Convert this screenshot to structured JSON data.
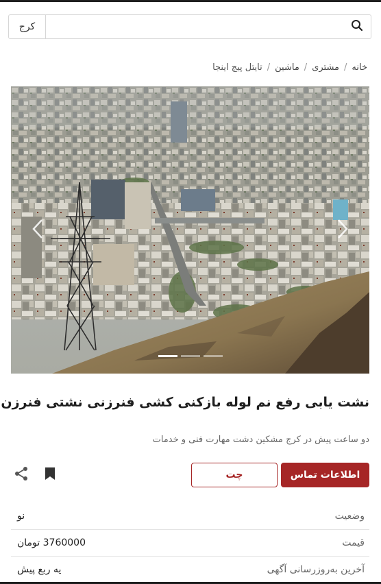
{
  "search": {
    "placeholder": "",
    "city": "کرج"
  },
  "breadcrumb": [
    {
      "label": "خانه"
    },
    {
      "label": "مشتری"
    },
    {
      "label": "ماشین"
    },
    {
      "label": "تایتل پیج اینجا"
    }
  ],
  "carousel": {
    "slide_count": 3,
    "active_index": 0
  },
  "listing": {
    "title": "نشت یابی رفع نم لوله بازکنی کشی فنرزنی نشتی فنرزن",
    "subtitle": "دو ساعت پیش در کرج مشکین دشت مهارت فنی و خدمات"
  },
  "actions": {
    "contact_label": "اطلاعات تماس",
    "chat_label": "چت",
    "bookmark_icon": "bookmark-icon",
    "share_icon": "share-icon"
  },
  "details": [
    {
      "label": "وضعیت",
      "value": "نو"
    },
    {
      "label": "قیمت",
      "value": "3760000 تومان"
    },
    {
      "label": "آخرین به‌روزرسانی آگهی",
      "value": "یه ربع پیش"
    }
  ],
  "colors": {
    "accent": "#a62626"
  }
}
